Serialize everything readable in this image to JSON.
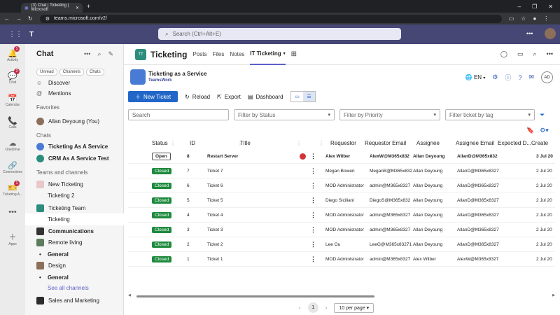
{
  "browser": {
    "tab_title": "(3) Chat | Ticketing | Microsoft",
    "url": "teams.microsoft.com/v2/"
  },
  "teams": {
    "search_placeholder": "Search (Ctrl+Alt+E)"
  },
  "rail": [
    {
      "label": "Activity",
      "icon": "🔔",
      "badge": "1"
    },
    {
      "label": "Chat",
      "icon": "💬",
      "badge": "2",
      "active": true
    },
    {
      "label": "Calendar",
      "icon": "📅"
    },
    {
      "label": "Calls",
      "icon": "📞"
    },
    {
      "label": "OneDrive",
      "icon": "☁"
    },
    {
      "label": "Connections",
      "icon": "🔗"
    },
    {
      "label": "Ticketing A...",
      "icon": "🎫",
      "badge": "1"
    },
    {
      "label": "...",
      "icon": "•••"
    },
    {
      "label": "Apps",
      "icon": "＋"
    }
  ],
  "chat_panel": {
    "title": "Chat",
    "filters": [
      "Unread",
      "Channels",
      "Chats"
    ],
    "items": [
      {
        "text": "Discover",
        "type": "link"
      },
      {
        "text": "Mentions",
        "type": "link"
      },
      {
        "text": "Favorites",
        "type": "header"
      },
      {
        "text": "Allan Deyoung (You)",
        "type": "person"
      },
      {
        "text": "Chats",
        "type": "header"
      },
      {
        "text": "Ticketing As A Service",
        "type": "app",
        "bold": true
      },
      {
        "text": "CRM As A Service Test",
        "type": "app",
        "bold": true
      },
      {
        "text": "Teams and channels",
        "type": "header"
      },
      {
        "text": "New Ticketing",
        "type": "team"
      },
      {
        "text": "Ticketing 2",
        "type": "channel"
      },
      {
        "text": "Ticketing Team",
        "type": "team"
      },
      {
        "text": "Ticketing",
        "type": "channel",
        "selected": true
      },
      {
        "text": "Communications",
        "type": "team",
        "bold": true
      },
      {
        "text": "Remote living",
        "type": "team"
      },
      {
        "text": "General",
        "type": "channel",
        "bold": true
      },
      {
        "text": "Design",
        "type": "team"
      },
      {
        "text": "General",
        "type": "channel",
        "bold": true
      },
      {
        "text": "See all channels",
        "type": "seeall"
      },
      {
        "text": "Sales and Marketing",
        "type": "team"
      }
    ]
  },
  "main": {
    "team_initials": "TT",
    "title": "Ticketing",
    "tabs": [
      "Posts",
      "Files",
      "Notes",
      "IT Ticketing"
    ],
    "app": {
      "name": "Ticketing as a Service",
      "sub": "TeamsWork",
      "lang": "EN",
      "user": "AD"
    },
    "toolbar": {
      "new": "New Ticket",
      "reload": "Reload",
      "export": "Export",
      "dashboard": "Dashboard"
    },
    "filters": {
      "search": "Search",
      "status": "Filter by Status",
      "priority": "Filter by Priority",
      "tag": "Filter ticket by tag"
    },
    "columns": [
      "Status",
      "ID",
      "Title",
      "Requestor",
      "Requestor Email",
      "Assignee",
      "Assignee Email",
      "Expected D...",
      "Create"
    ],
    "rows": [
      {
        "status": "Open",
        "id": "8",
        "title": "Restart Server",
        "requestor": "Alex Wilber",
        "req_email": "AlexW@M365x832",
        "assignee": "Allan Deyoung",
        "asg_email": "AllanD@M365x832",
        "created": "3 Jul 20",
        "bold": true
      },
      {
        "status": "Closed",
        "id": "7",
        "title": "Ticket 7",
        "requestor": "Megan Bowen",
        "req_email": "MeganB@M365x832",
        "assignee": "Allan Deyoung",
        "asg_email": "AllanD@M365x8327",
        "created": "2 Jul 20"
      },
      {
        "status": "Closed",
        "id": "6",
        "title": "Ticket 6",
        "requestor": "MOD Administrator",
        "req_email": "admin@M365x8327",
        "assignee": "Allan Deyoung",
        "asg_email": "AllanD@M365x8327",
        "created": "2 Jul 20"
      },
      {
        "status": "Closed",
        "id": "5",
        "title": "Ticket 5",
        "requestor": "Diego Siciliani",
        "req_email": "DiegoS@M365x832",
        "assignee": "Allan Deyoung",
        "asg_email": "AllanD@M365x8327",
        "created": "2 Jul 20"
      },
      {
        "status": "Closed",
        "id": "4",
        "title": "Ticket 4",
        "requestor": "MOD Administrator",
        "req_email": "admin@M365x8327",
        "assignee": "Allan Deyoung",
        "asg_email": "AllanD@M365x8327",
        "created": "2 Jul 20"
      },
      {
        "status": "Closed",
        "id": "3",
        "title": "Ticket 3",
        "requestor": "MOD Administrator",
        "req_email": "admin@M365x8327",
        "assignee": "Allan Deyoung",
        "asg_email": "AllanD@M365x8327",
        "created": "2 Jul 20"
      },
      {
        "status": "Closed",
        "id": "2",
        "title": "Ticket 2",
        "requestor": "Lee Gu",
        "req_email": "LeeG@M365x83271",
        "assignee": "Allan Deyoung",
        "asg_email": "AllanD@M365x8327",
        "created": "2 Jul 20"
      },
      {
        "status": "Closed",
        "id": "1",
        "title": "Ticket 1",
        "requestor": "MOD Administrator",
        "req_email": "admin@M365x8327",
        "assignee": "Alex Wilber",
        "asg_email": "AlexW@M365x8327",
        "created": "2 Jul 20"
      }
    ],
    "pager": {
      "page": "1",
      "per_page": "10 per page"
    }
  }
}
